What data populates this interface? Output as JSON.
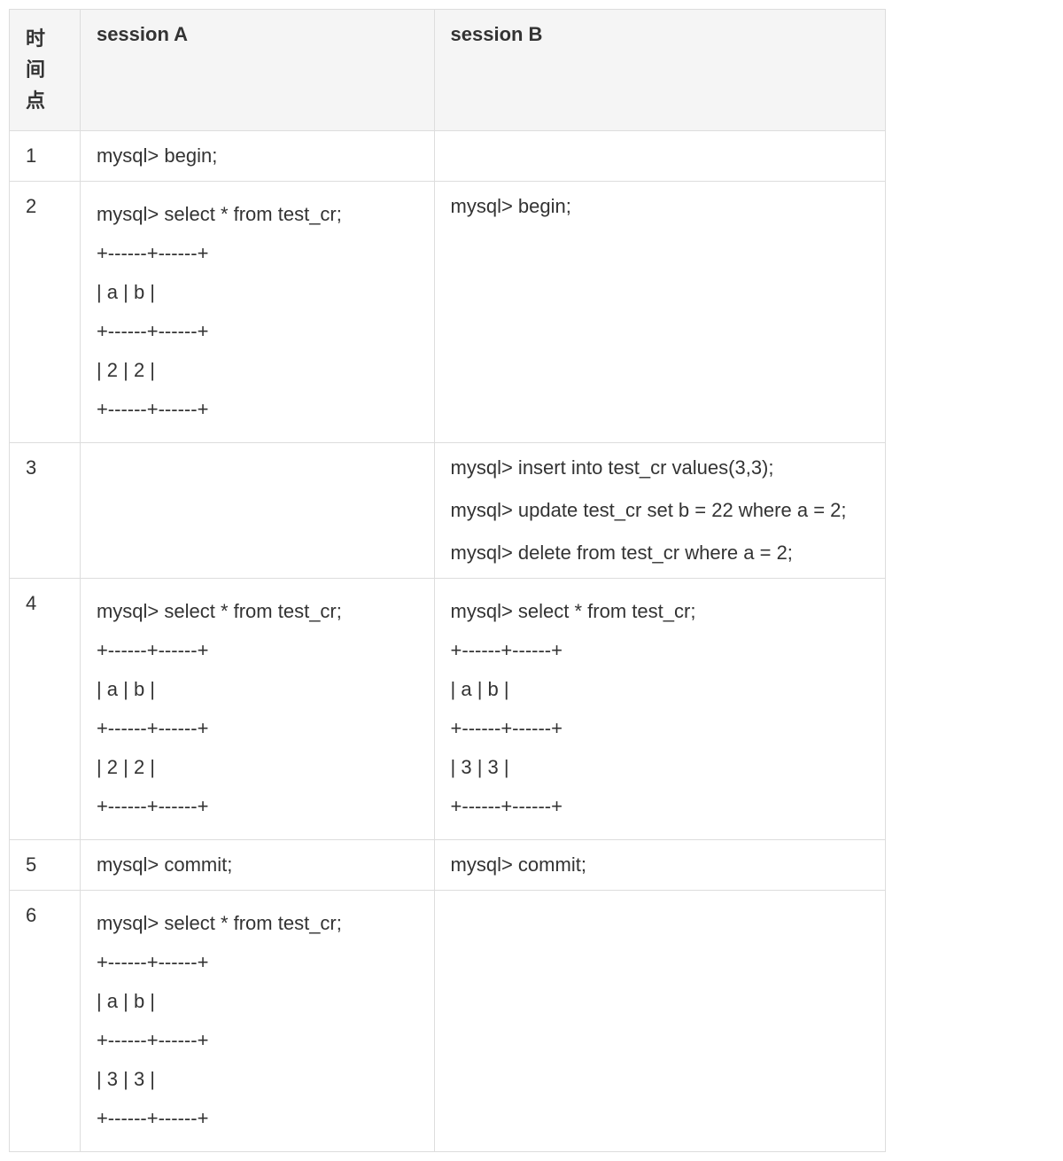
{
  "headers": {
    "time": "时间点",
    "sessionA": "session A",
    "sessionB": "session B"
  },
  "rows": [
    {
      "time": "1",
      "sessionA": {
        "cmd": "mysql> begin;"
      },
      "sessionB": {}
    },
    {
      "time": "2",
      "sessionA": {
        "cmd": "mysql> select * from test_cr;",
        "out1": "+------+------+",
        "out2": "| a | b |",
        "out3": "+------+------+",
        "out4": "| 2 | 2 |",
        "out5": "+------+------+"
      },
      "sessionB": {
        "cmd": "mysql> begin;"
      }
    },
    {
      "time": "3",
      "sessionA": {},
      "sessionB": {
        "cmd1": "mysql> insert into test_cr values(3,3);",
        "cmd2": "mysql> update test_cr set b = 22 where a = 2;",
        "cmd3": "mysql> delete from test_cr where a = 2;"
      }
    },
    {
      "time": "4",
      "sessionA": {
        "cmd": "mysql> select * from test_cr;",
        "out1": "+------+------+",
        "out2": "| a | b |",
        "out3": "+------+------+",
        "out4": "| 2 | 2 |",
        "out5": "+------+------+"
      },
      "sessionB": {
        "cmd": "mysql> select * from test_cr;",
        "out1": "+------+------+",
        "out2": "| a | b |",
        "out3": "+------+------+",
        "out4": "| 3 | 3 |",
        "out5": "+------+------+"
      }
    },
    {
      "time": "5",
      "sessionA": {
        "cmd": "mysql> commit;"
      },
      "sessionB": {
        "cmd": "mysql> commit;"
      }
    },
    {
      "time": "6",
      "sessionA": {
        "cmd": "mysql> select * from test_cr;",
        "out1": "+------+------+",
        "out2": "| a | b |",
        "out3": "+------+------+",
        "out4": "| 3 | 3 |",
        "out5": "+------+------+"
      },
      "sessionB": {}
    }
  ]
}
